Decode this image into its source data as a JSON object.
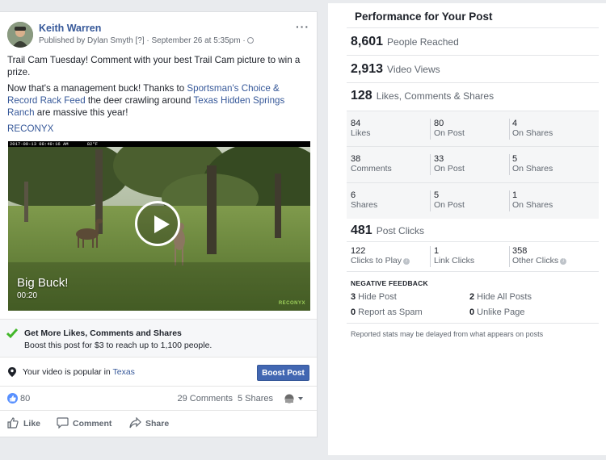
{
  "post": {
    "author": "Keith Warren",
    "meta": "Published by Dylan Smyth [?] · September 26 at 5:35pm · ",
    "more_label": "···",
    "text1": "Trail Cam Tuesday! Comment with your best Trail Cam picture to win a prize.",
    "text2_a": "Now that's a management buck! Thanks to ",
    "text2_link1": "Sportsman's Choice & Record Rack Feed",
    "text2_b": " the deer crawling around ",
    "text2_link2": "Texas Hidden Springs Ranch",
    "text2_c": " are massive this year!",
    "tag": "RECONYX",
    "video": {
      "cam_bar": "2017-09-13 08:49:16 AM       82°F",
      "title": "Big Buck!",
      "duration": "00:20",
      "watermark": "RECONYX"
    },
    "boost": {
      "title": "Get More Likes, Comments and Shares",
      "subtitle": "Boost this post for $3 to reach up to 1,100 people."
    },
    "popular": {
      "text": "Your video is popular in ",
      "place": "Texas",
      "button": "Boost Post"
    },
    "reactions": {
      "likes": "80",
      "comments": "29 Comments",
      "shares": "5 Shares"
    },
    "actions": {
      "like": "Like",
      "comment": "Comment",
      "share": "Share"
    }
  },
  "performance": {
    "title": "Performance for Your Post",
    "reached": {
      "value": "8,601",
      "label": "People Reached"
    },
    "views": {
      "value": "2,913",
      "label": "Video Views"
    },
    "engagement": {
      "value": "128",
      "label": "Likes, Comments & Shares"
    },
    "grid": [
      [
        {
          "n": "84",
          "l": "Likes"
        },
        {
          "n": "80",
          "l": "On Post"
        },
        {
          "n": "4",
          "l": "On Shares"
        }
      ],
      [
        {
          "n": "38",
          "l": "Comments"
        },
        {
          "n": "33",
          "l": "On Post"
        },
        {
          "n": "5",
          "l": "On Shares"
        }
      ],
      [
        {
          "n": "6",
          "l": "Shares"
        },
        {
          "n": "5",
          "l": "On Post"
        },
        {
          "n": "1",
          "l": "On Shares"
        }
      ]
    ],
    "clicks": {
      "value": "481",
      "label": "Post Clicks"
    },
    "click_breakdown": [
      {
        "n": "122",
        "l": "Clicks to Play"
      },
      {
        "n": "1",
        "l": "Link Clicks"
      },
      {
        "n": "358",
        "l": "Other Clicks"
      }
    ],
    "negative_title": "NEGATIVE FEEDBACK",
    "negative": [
      {
        "n": "3",
        "l": "Hide Post"
      },
      {
        "n": "2",
        "l": "Hide All Posts"
      },
      {
        "n": "0",
        "l": "Report as Spam"
      },
      {
        "n": "0",
        "l": "Unlike Page"
      }
    ],
    "note": "Reported stats may be delayed from what appears on posts"
  },
  "colors": {
    "brand": "#4267b2",
    "link": "#365899",
    "boost_check": "#42b72a",
    "like_blue": "#5890ff"
  },
  "icons": [
    "globe-icon",
    "check-icon",
    "map-pin-icon",
    "like-icon",
    "comment-icon",
    "share-icon",
    "play-icon",
    "info-icon",
    "audience-icon"
  ]
}
